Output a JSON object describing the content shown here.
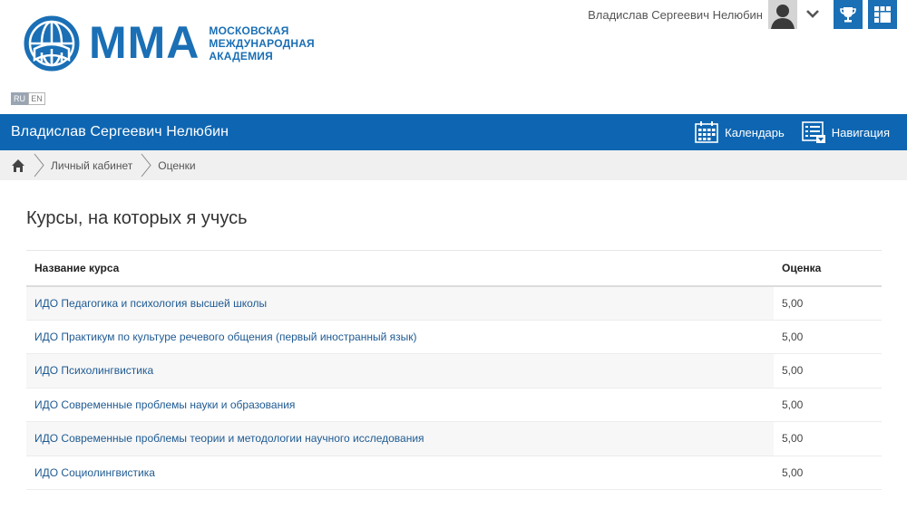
{
  "header": {
    "logo_abbr": "ММА",
    "logo_lines": [
      "МОСКОВСКАЯ",
      "МЕЖДУНАРОДНАЯ",
      "АКАДЕМИЯ"
    ],
    "user_name": "Владислав Сергеевич Нелюбин",
    "languages": [
      "RU",
      "EN"
    ],
    "active_language": "RU",
    "icons": {
      "avatar": "user-avatar",
      "menu": "chevron-down-icon",
      "achievements": "trophy-icon",
      "apps": "grid-icon"
    }
  },
  "navbar": {
    "title": "Владислав Сергеевич Нелюбин",
    "calendar_label": "Календарь",
    "navigation_label": "Навигация"
  },
  "breadcrumb": {
    "items": [
      "Личный кабинет",
      "Оценки"
    ]
  },
  "main": {
    "title": "Курсы, на которых я учусь",
    "table": {
      "headers": [
        "Название курса",
        "Оценка"
      ],
      "rows": [
        {
          "course": "ИДО Педагогика и психология высшей школы",
          "grade": "5,00"
        },
        {
          "course": "ИДО Практикум по культуре речевого общения (первый иностранный язык)",
          "grade": "5,00"
        },
        {
          "course": "ИДО Психолингвистика",
          "grade": "5,00"
        },
        {
          "course": "ИДО Современные проблемы науки и образования",
          "grade": "5,00"
        },
        {
          "course": "ИДО Современные проблемы теории и методологии научного исследования",
          "grade": "5,00"
        },
        {
          "course": "ИДО Социолингвистика",
          "grade": "5,00"
        }
      ]
    }
  },
  "colors": {
    "brand_blue": "#0e66b2",
    "logo_blue": "#1a6fb5",
    "link": "#1e5a92"
  }
}
